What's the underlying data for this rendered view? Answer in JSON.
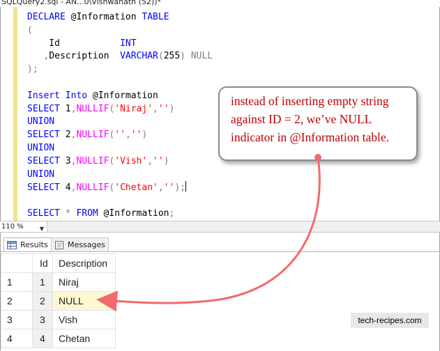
{
  "document_tab": {
    "title": "SQLQuery2.sql - AN...0\\Vishwanath (52))*"
  },
  "editor": {
    "lines": [
      [
        {
          "t": "DECLARE",
          "c": "kw"
        },
        {
          "t": " @Information ",
          "c": ""
        },
        {
          "t": "TABLE",
          "c": "kw"
        }
      ],
      [
        {
          "t": "(",
          "c": "op"
        }
      ],
      [
        {
          "t": "    Id           ",
          "c": ""
        },
        {
          "t": "INT",
          "c": "kw"
        }
      ],
      [
        {
          "t": "   ",
          "c": ""
        },
        {
          "t": ",",
          "c": "op"
        },
        {
          "t": "Description  ",
          "c": ""
        },
        {
          "t": "VARCHAR",
          "c": "kw"
        },
        {
          "t": "(",
          "c": "op"
        },
        {
          "t": "255",
          "c": ""
        },
        {
          "t": ")",
          "c": "op"
        },
        {
          "t": " ",
          "c": ""
        },
        {
          "t": "NULL",
          "c": "gray"
        }
      ],
      [
        {
          "t": ");",
          "c": "op"
        }
      ],
      [
        {
          "t": "",
          "c": ""
        }
      ],
      [
        {
          "t": "Insert Into",
          "c": "kw"
        },
        {
          "t": " @Information",
          "c": ""
        }
      ],
      [
        {
          "t": "SELECT",
          "c": "kw"
        },
        {
          "t": " 1",
          "c": ""
        },
        {
          "t": ",",
          "c": "op"
        },
        {
          "t": "NULLIF",
          "c": "fn"
        },
        {
          "t": "(",
          "c": "op"
        },
        {
          "t": "'Niraj'",
          "c": "str"
        },
        {
          "t": ",",
          "c": "op"
        },
        {
          "t": "''",
          "c": "str"
        },
        {
          "t": ")",
          "c": "op"
        }
      ],
      [
        {
          "t": "UNION",
          "c": "kw"
        }
      ],
      [
        {
          "t": "SELECT",
          "c": "kw"
        },
        {
          "t": " 2",
          "c": ""
        },
        {
          "t": ",",
          "c": "op"
        },
        {
          "t": "NULLIF",
          "c": "fn"
        },
        {
          "t": "(",
          "c": "op"
        },
        {
          "t": "''",
          "c": "str"
        },
        {
          "t": ",",
          "c": "op"
        },
        {
          "t": "''",
          "c": "str"
        },
        {
          "t": ")",
          "c": "op"
        }
      ],
      [
        {
          "t": "UNION",
          "c": "kw"
        }
      ],
      [
        {
          "t": "SELECT",
          "c": "kw"
        },
        {
          "t": " 3",
          "c": ""
        },
        {
          "t": ",",
          "c": "op"
        },
        {
          "t": "NULLIF",
          "c": "fn"
        },
        {
          "t": "(",
          "c": "op"
        },
        {
          "t": "'Vish'",
          "c": "str"
        },
        {
          "t": ",",
          "c": "op"
        },
        {
          "t": "''",
          "c": "str"
        },
        {
          "t": ")",
          "c": "op"
        }
      ],
      [
        {
          "t": "UNION",
          "c": "kw"
        }
      ],
      [
        {
          "t": "SELECT",
          "c": "kw"
        },
        {
          "t": " 4",
          "c": ""
        },
        {
          "t": ",",
          "c": "op"
        },
        {
          "t": "NULLIF",
          "c": "fn"
        },
        {
          "t": "(",
          "c": "op"
        },
        {
          "t": "'Chetan'",
          "c": "str"
        },
        {
          "t": ",",
          "c": "op"
        },
        {
          "t": "''",
          "c": "str"
        },
        {
          "t": ");",
          "c": "op"
        }
      ],
      [
        {
          "t": "",
          "c": ""
        }
      ],
      [
        {
          "t": "SELECT",
          "c": "kw"
        },
        {
          "t": " ",
          "c": ""
        },
        {
          "t": "*",
          "c": "op"
        },
        {
          "t": " ",
          "c": ""
        },
        {
          "t": "FROM",
          "c": "kw"
        },
        {
          "t": " @Information",
          "c": ""
        },
        {
          "t": ";",
          "c": "op"
        }
      ]
    ]
  },
  "zoom": {
    "level": "110 %"
  },
  "results_tabs": {
    "results_label": "Results",
    "messages_label": "Messages"
  },
  "grid": {
    "columns": [
      "",
      "Id",
      "Description"
    ],
    "rows": [
      {
        "rownum": "1",
        "id": "1",
        "description": "Niraj"
      },
      {
        "rownum": "2",
        "id": "2",
        "description": "NULL"
      },
      {
        "rownum": "3",
        "id": "3",
        "description": "Vish"
      },
      {
        "rownum": "4",
        "id": "4",
        "description": "Chetan"
      }
    ]
  },
  "callout": {
    "text": "instead of inserting empty string\nagainst ID = 2, we’ve NULL\nindicator in @Information table."
  },
  "watermark": {
    "text": "tech-recipes.com"
  },
  "colors": {
    "keyword": "#0000ff",
    "function": "#ff00ff",
    "string": "#ff0000",
    "callout_text": "#c00000",
    "arrow": "#f26a6a"
  }
}
